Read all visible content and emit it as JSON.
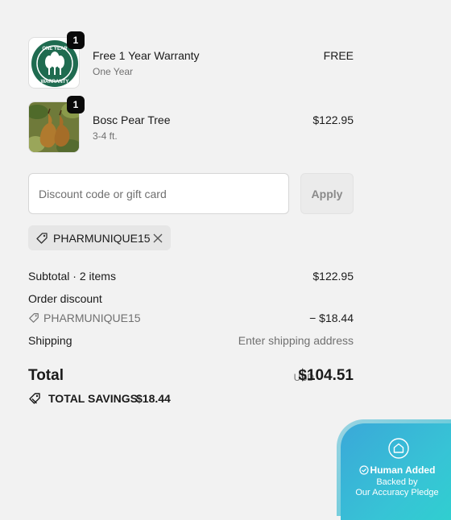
{
  "items": [
    {
      "qty": "1",
      "title": "Free 1 Year Warranty",
      "subtitle": "One Year",
      "price": "FREE",
      "badge_text": [
        "ONE YEAR",
        "WARRANTY"
      ]
    },
    {
      "qty": "1",
      "title": "Bosc Pear Tree",
      "subtitle": "3-4 ft.",
      "price": "$122.95"
    }
  ],
  "discount": {
    "placeholder": "Discount code or gift card",
    "apply_label": "Apply",
    "applied_code": "PHARMUNIQUE15"
  },
  "summary": {
    "subtotal_label": "Subtotal · 2 items",
    "subtotal_value": "$122.95",
    "order_discount_label": "Order discount",
    "discount_code": "PHARMUNIQUE15",
    "discount_value": "− $18.44",
    "shipping_label": "Shipping",
    "shipping_value": "Enter shipping address",
    "total_label": "Total",
    "currency": "USD",
    "total_value": "$104.51",
    "savings_label": "TOTAL SAVINGS",
    "savings_value": "$18.44"
  },
  "pledge": {
    "title": "Human Added",
    "line1": "Backed by",
    "line2": "Our Accuracy Pledge"
  },
  "colors": {
    "pledge_gradient": [
      "#3aa8d8",
      "#2fd0cf"
    ],
    "warranty_green": "#1f6b50"
  }
}
